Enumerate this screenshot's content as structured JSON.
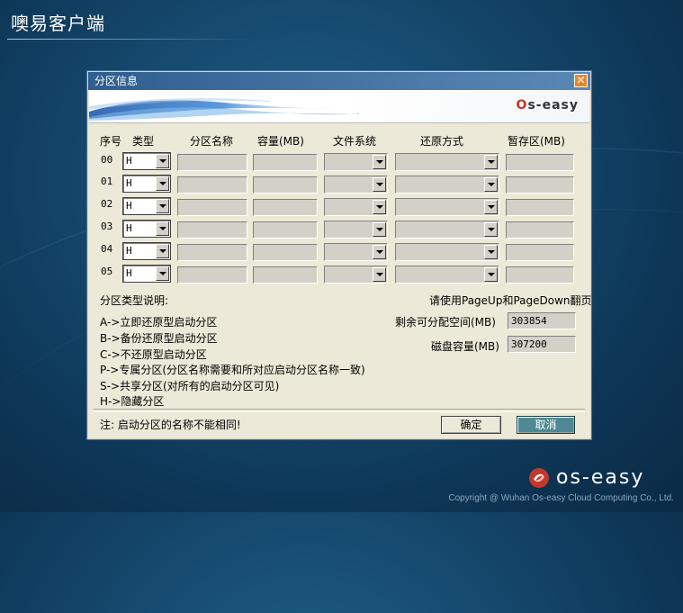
{
  "app": {
    "title": "噢易客户端"
  },
  "dialog": {
    "title": "分区信息",
    "close_label": "✕",
    "logo_text": "s-easy",
    "logo_o": "O",
    "headers": {
      "index": "序号",
      "type": "类型",
      "name": "分区名称",
      "capacity": "容量(MB)",
      "filesystem": "文件系统",
      "restore_mode": "还原方式",
      "temp_area": "暂存区(MB)"
    },
    "rows": [
      {
        "index": "00",
        "type": "H"
      },
      {
        "index": "01",
        "type": "H"
      },
      {
        "index": "02",
        "type": "H"
      },
      {
        "index": "03",
        "type": "H"
      },
      {
        "index": "04",
        "type": "H"
      },
      {
        "index": "05",
        "type": "H"
      }
    ],
    "type_help_title": "分区类型说明:",
    "type_help": [
      "A->立即还原型启动分区",
      "B->备份还原型启动分区",
      "C->不还原型启动分区",
      "P->专属分区(分区名称需要和所对应启动分区名称一致)",
      "S->共享分区(对所有的启动分区可见)",
      "H->隐藏分区"
    ],
    "paging_hint": "请使用PageUp和PageDown翻页",
    "remaining_label": "剩余可分配空间(MB)",
    "remaining_value": "303854",
    "disk_label": "磁盘容量(MB)",
    "disk_value": "307200",
    "note": "注: 启动分区的名称不能相同!",
    "ok_label": "确定",
    "cancel_label": "取消"
  },
  "footer": {
    "logo_text": "os-easy",
    "copyright": "Copyright @ Wuhan Os-easy Cloud Computing Co., Ltd."
  }
}
